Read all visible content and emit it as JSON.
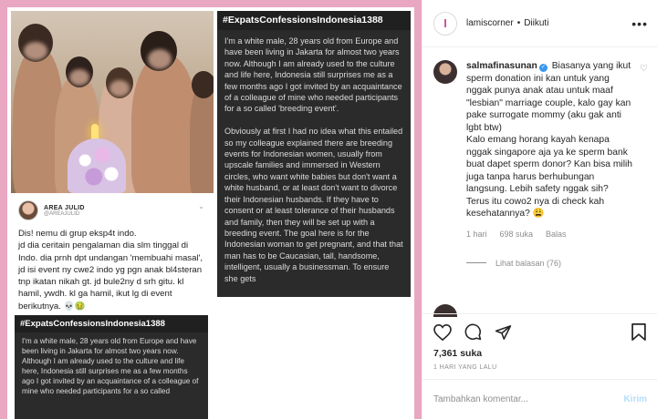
{
  "post": {
    "tweet": {
      "name": "AREA JULID",
      "handle": "@AREAJULID",
      "chevron": "⌄",
      "text": "Dis! nemu di grup eksp4t indo.\njd dia ceritain pengalaman dia slm tinggal di Indo. dia prnh dpt undangan 'membuahi masal', jd isi event ny cwe2 indo yg pgn anak bl4steran tnp ikatan nikah gt. jd bule2ny d srh gitu. kl hamil, ywdh. kl ga hamil, ikut lg di event berikutnya. 💀🤢"
    },
    "confession_large": {
      "tag": "#ExpatsConfessionsIndonesia1388",
      "text": "I'm a white male, 28 years old from Europe and have been living in Jakarta for almost two years now. Although I am already used to the culture and life here, Indonesia still surprises me as a few months ago I got invited by an acquaintance of a colleague of mine who needed participants for a so called 'breeding event'.\n\nObviously at first I had no idea what this entailed so my colleague explained there are breeding events for Indonesian women, usually from upscale families and immersed in Western circles, who want white babies but don't want a white husband, or at least don't want to divorce their Indonesian husbands. If they have to consent or at least tolerance of their husbands and family, then they will be set up with a breeding event. The goal here is for the Indonesian woman to get pregnant, and that that man has to be Caucasian, tall, handsome, intelligent, usually a businessman. To ensure she gets"
    },
    "confession_small": {
      "tag": "#ExpatsConfessionsIndonesia1388",
      "text": "I'm a white male, 28 years old from Europe and have been living in Jakarta for almost two years now. Although I am already used to the culture and life here, Indonesia still surprises me as a few months ago I got invited by an acquaintance of a colleague of mine who needed participants for a so called"
    }
  },
  "header": {
    "avatar_letter": "l",
    "username": "lamiscorner",
    "separator": "•",
    "follow_state": "Diikuti",
    "more": "•••"
  },
  "comment": {
    "username": "salmafinasunan",
    "verified_mark": "✓",
    "text": " Biasanya yang ikut sperm donation ini kan untuk yang nggak punya anak atau untuk maaf \"lesbian\" marriage couple, kalo gay kan pake surrogate mommy (aku gak anti lgbt btw)\nKalo emang horang kayah kenapa nggak singapore aja ya ke sperm bank buat dapet sperm donor? Kan bisa milih juga tanpa harus berhubungan langsung. Lebih safety nggak sih?\nTerus itu cowo2 nya di check kah kesehatannya? 😩",
    "heart": "♡",
    "time": "1 hari",
    "likes": "698 suka",
    "reply": "Balas",
    "view_replies": "Lihat balasan (76)"
  },
  "actions": {
    "likes": "7,361 suka",
    "date": "1 HARI YANG LALU"
  },
  "add_comment": {
    "placeholder": "Tambahkan komentar...",
    "send": "Kirim"
  },
  "colors": {
    "frame_pink": "#e9a7c2",
    "card_dark": "#2b2b2b",
    "verified_blue": "#3897f0",
    "send_disabled": "#b2dffc"
  }
}
